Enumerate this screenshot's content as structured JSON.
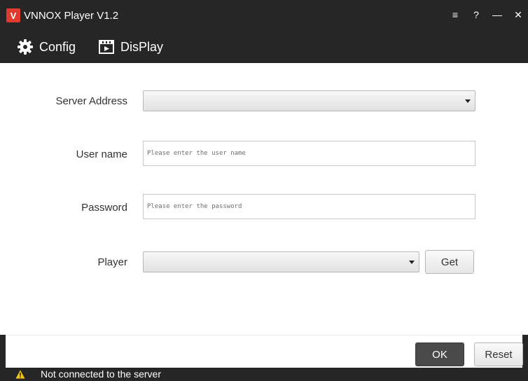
{
  "window": {
    "logo_letter": "V",
    "title": "VNNOX Player V1.2",
    "controls": {
      "menu": "≡",
      "help": "?",
      "minimize": "—",
      "close": "✕"
    }
  },
  "tabs": [
    {
      "label": "Config",
      "icon": "gear-icon",
      "selected": true
    },
    {
      "label": "DisPlay",
      "icon": "display-icon",
      "selected": false
    }
  ],
  "form": {
    "server_address": {
      "label": "Server Address",
      "value": ""
    },
    "user_name": {
      "label": "User name",
      "placeholder": "Please enter the user name"
    },
    "password": {
      "label": "Password",
      "placeholder": "Please enter the password"
    },
    "player": {
      "label": "Player",
      "value": "",
      "get_label": "Get"
    }
  },
  "footer": {
    "ok_label": "OK",
    "reset_label": "Reset"
  },
  "status": {
    "icon": "warning-icon",
    "text": "Not connected to the server"
  },
  "colors": {
    "chrome": "#262626",
    "logo": "#e03a2e",
    "warning": "#f5c518",
    "ok_button": "#4a4a4a"
  }
}
